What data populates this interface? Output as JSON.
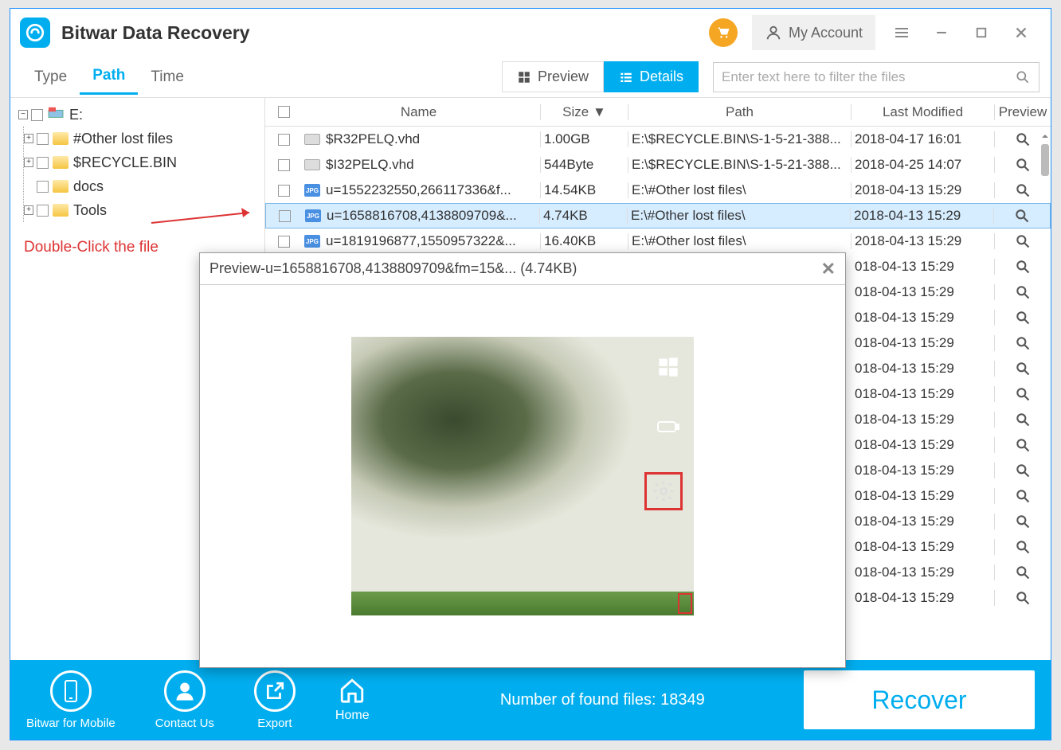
{
  "app": {
    "title": "Bitwar Data Recovery",
    "account_label": "My Account"
  },
  "tabs": {
    "type": "Type",
    "path": "Path",
    "time": "Time",
    "active": "path"
  },
  "view": {
    "preview": "Preview",
    "details": "Details"
  },
  "search": {
    "placeholder": "Enter text here to filter the files"
  },
  "tree": {
    "root": "E:",
    "children": [
      {
        "label": "#Other lost files"
      },
      {
        "label": "$RECYCLE.BIN"
      },
      {
        "label": "docs"
      },
      {
        "label": "Tools"
      }
    ]
  },
  "columns": {
    "name": "Name",
    "size": "Size",
    "path": "Path",
    "modified": "Last Modified",
    "preview": "Preview"
  },
  "files": [
    {
      "name": "$R32PELQ.vhd",
      "size": "1.00GB",
      "path": "E:\\$RECYCLE.BIN\\S-1-5-21-388...",
      "mod": "2018-04-17  16:01",
      "type": "vhd"
    },
    {
      "name": "$I32PELQ.vhd",
      "size": "544Byte",
      "path": "E:\\$RECYCLE.BIN\\S-1-5-21-388...",
      "mod": "2018-04-25  14:07",
      "type": "vhd"
    },
    {
      "name": "u=1552232550,266117336&f...",
      "size": "14.54KB",
      "path": "E:\\#Other lost files\\",
      "mod": "2018-04-13  15:29",
      "type": "jpg"
    },
    {
      "name": "u=1658816708,4138809709&...",
      "size": "4.74KB",
      "path": "E:\\#Other lost files\\",
      "mod": "2018-04-13  15:29",
      "type": "jpg",
      "selected": true
    },
    {
      "name": "u=1819196877,1550957322&...",
      "size": "16.40KB",
      "path": "E:\\#Other lost files\\",
      "mod": "2018-04-13  15:29",
      "type": "jpg"
    },
    {
      "name": "",
      "size": "",
      "path": "",
      "mod": "018-04-13  15:29",
      "type": "jpg",
      "partial": true
    },
    {
      "name": "",
      "size": "",
      "path": "",
      "mod": "018-04-13  15:29",
      "type": "jpg",
      "partial": true
    },
    {
      "name": "",
      "size": "",
      "path": "",
      "mod": "018-04-13  15:29",
      "type": "jpg",
      "partial": true
    },
    {
      "name": "",
      "size": "",
      "path": "",
      "mod": "018-04-13  15:29",
      "type": "jpg",
      "partial": true
    },
    {
      "name": "",
      "size": "",
      "path": "",
      "mod": "018-04-13  15:29",
      "type": "jpg",
      "partial": true
    },
    {
      "name": "",
      "size": "",
      "path": "",
      "mod": "018-04-13  15:29",
      "type": "jpg",
      "partial": true
    },
    {
      "name": "",
      "size": "",
      "path": "",
      "mod": "018-04-13  15:29",
      "type": "jpg",
      "partial": true
    },
    {
      "name": "",
      "size": "",
      "path": "",
      "mod": "018-04-13  15:29",
      "type": "jpg",
      "partial": true
    },
    {
      "name": "",
      "size": "",
      "path": "",
      "mod": "018-04-13  15:29",
      "type": "jpg",
      "partial": true
    },
    {
      "name": "",
      "size": "",
      "path": "",
      "mod": "018-04-13  15:29",
      "type": "jpg",
      "partial": true
    },
    {
      "name": "",
      "size": "",
      "path": "",
      "mod": "018-04-13  15:29",
      "type": "jpg",
      "partial": true
    },
    {
      "name": "",
      "size": "",
      "path": "",
      "mod": "018-04-13  15:29",
      "type": "jpg",
      "partial": true
    },
    {
      "name": "",
      "size": "",
      "path": "",
      "mod": "018-04-13  15:29",
      "type": "jpg",
      "partial": true
    },
    {
      "name": "",
      "size": "",
      "path": "",
      "mod": "018-04-13  15:29",
      "type": "jpg",
      "partial": true
    }
  ],
  "popup": {
    "title": "Preview-u=1658816708,4138809709&fm=15&... (4.74KB)"
  },
  "footer": {
    "mobile": "Bitwar for Mobile",
    "contact": "Contact Us",
    "export": "Export",
    "home": "Home",
    "status": "Number of found files: 18349",
    "recover": "Recover"
  },
  "annotation": {
    "hint": "Double-Click the file"
  }
}
